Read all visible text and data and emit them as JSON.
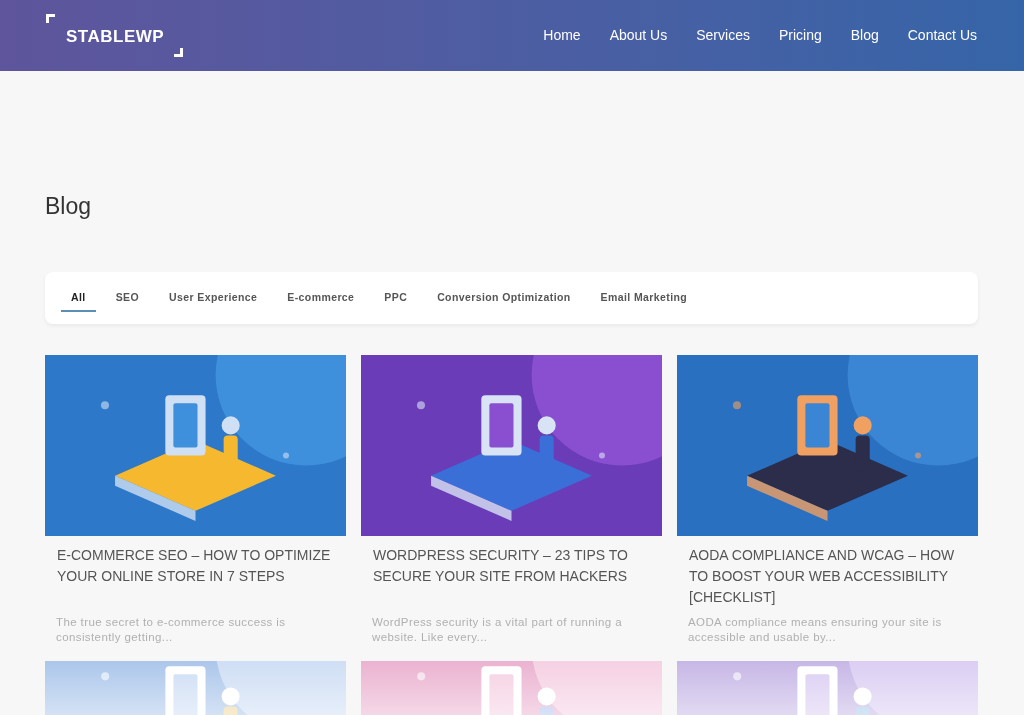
{
  "header": {
    "logo": "STABLEWP",
    "nav": [
      {
        "label": "Home"
      },
      {
        "label": "About Us"
      },
      {
        "label": "Services"
      },
      {
        "label": "Pricing"
      },
      {
        "label": "Blog"
      },
      {
        "label": "Contact Us"
      }
    ]
  },
  "page_title": "Blog",
  "filter_tabs": [
    {
      "label": "All",
      "selected": true
    },
    {
      "label": "SEO",
      "selected": false
    },
    {
      "label": "User Experience",
      "selected": false
    },
    {
      "label": "E-commerce",
      "selected": false
    },
    {
      "label": "PPC",
      "selected": false
    },
    {
      "label": "Conversion Optimization",
      "selected": false
    },
    {
      "label": "Email Marketing",
      "selected": false
    }
  ],
  "posts": [
    {
      "kind": "post",
      "title": "E-COMMERCE SEO – HOW TO OPTIMIZE YOUR ONLINE STORE IN 7 STEPS",
      "excerpt": "The true secret to e-commerce success is consistently getting..."
    },
    {
      "kind": "post",
      "title": "WORDPRESS SECURITY – 23 TIPS TO SECURE YOUR SITE FROM HACKERS",
      "excerpt": "WordPress security is a vital part of running a website. Like every..."
    },
    {
      "kind": "post",
      "title": "AODA COMPLIANCE AND WCAG – HOW TO BOOST YOUR WEB ACCESSIBILITY [CHECKLIST]",
      "excerpt": "AODA compliance means ensuring your site is accessible and usable by..."
    },
    {
      "kind": "picture"
    },
    {
      "kind": "picture"
    },
    {
      "kind": "picture"
    }
  ]
}
